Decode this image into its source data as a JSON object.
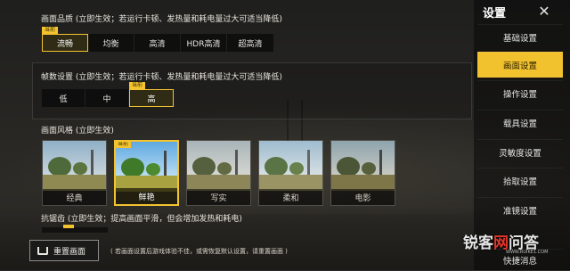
{
  "graphics_quality": {
    "title": "画面品质 (立即生效；若运行卡顿、发热量和耗电量过大可适当降低)",
    "current_tag": "当前",
    "options": [
      "流畅",
      "均衡",
      "高清",
      "HDR高清",
      "超高清"
    ],
    "selected": "流畅"
  },
  "frame_rate": {
    "title": "帧数设置 (立即生效；若运行卡顿、发热量和耗电量过大可适当降低)",
    "current_tag": "当前",
    "options": [
      "低",
      "中",
      "高"
    ],
    "selected": "高"
  },
  "style": {
    "title": "画面风格 (立即生效)",
    "current_tag": "当前",
    "options": [
      "经典",
      "鲜艳",
      "写实",
      "柔和",
      "电影"
    ],
    "selected": "鲜艳"
  },
  "anti_aliasing": {
    "title": "抗锯齿 (立即生效；提高画面平滑，但会增加发热和耗电)"
  },
  "reset": {
    "button_label": "重置画面",
    "note": "( 若画面设置后游戏体验不佳，或需恢复默认设置，请重置画面 )"
  },
  "sidebar": {
    "title": "设置",
    "close_symbol": "✕",
    "items": [
      "基础设置",
      "画面设置",
      "操作设置",
      "载具设置",
      "灵敏度设置",
      "拾取设置",
      "准镜设置",
      "快捷消息"
    ],
    "active": "画面设置"
  },
  "watermark": {
    "text_a": "锐客",
    "text_b": "网",
    "text_c": "问答",
    "sub": "WWW.RUIKE1.COM"
  },
  "colors": {
    "accent": "#f2c12e"
  }
}
